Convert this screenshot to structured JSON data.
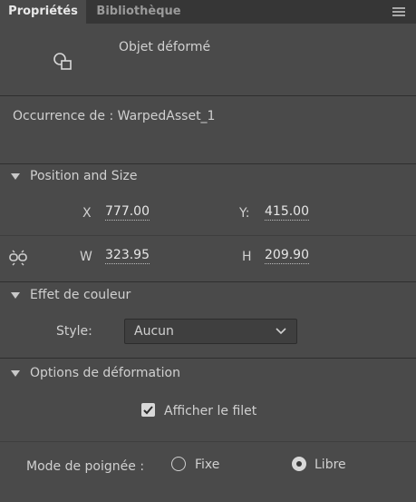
{
  "tabs": [
    {
      "label": "Propriétés"
    },
    {
      "label": "Bibliothèque"
    }
  ],
  "header": {
    "title": "Objet déformé"
  },
  "instance": {
    "label": "Occurrence de :",
    "value": "WarpedAsset_1"
  },
  "position_size": {
    "title": "Position and Size",
    "x_label": "X",
    "x_value": "777.00",
    "y_label": "Y:",
    "y_value": "415.00",
    "w_label": "W",
    "w_value": "323.95",
    "h_label": "H",
    "h_value": "209.90"
  },
  "color_effect": {
    "title": "Effet de couleur",
    "style_label": "Style:",
    "style_value": "Aucun"
  },
  "warp_options": {
    "title": "Options de déformation",
    "show_mesh_label": "Afficher le filet",
    "show_mesh_checked": true,
    "handle_mode_label": "Mode de poignée :",
    "option_fixed": "Fixe",
    "option_free": "Libre",
    "selected": "Libre"
  }
}
